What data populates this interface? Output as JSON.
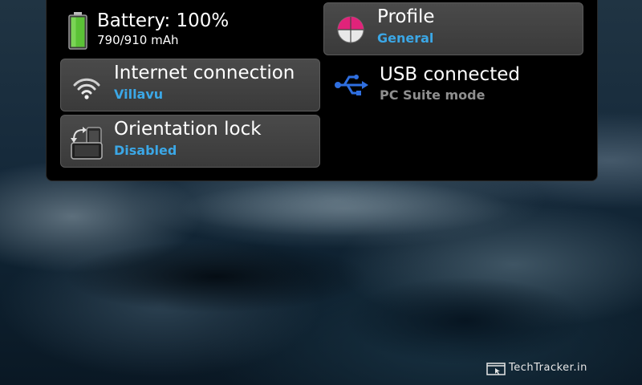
{
  "battery": {
    "title": "Battery: 100%",
    "detail": "790/910 mAh",
    "level": 1.0
  },
  "profile": {
    "title": "Profile",
    "value": "General"
  },
  "internet": {
    "title": "Internet connection",
    "value": "Villavu"
  },
  "usb": {
    "title": "USB connected",
    "value": "PC Suite mode"
  },
  "orientation": {
    "title": "Orientation lock",
    "value": "Disabled"
  },
  "watermark": {
    "text": "TechTracker.in"
  },
  "colors": {
    "accent": "#3ba7e6",
    "battery_green": "#5bc236",
    "usb_blue": "#2f6fe0",
    "profile_pink": "#e0237a"
  },
  "icons": {
    "battery": "battery-icon",
    "profile": "profile-icon",
    "internet": "wifi-icon",
    "usb": "usb-icon",
    "orientation": "orientation-icon"
  }
}
